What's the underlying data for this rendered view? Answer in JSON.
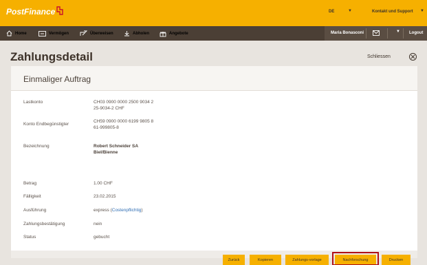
{
  "brand": {
    "logo_text": "PostFinance",
    "accent": "#f6b000",
    "nav_bg": "#4b3f35"
  },
  "header": {
    "language": "DE",
    "contact": "Kontakt und Support"
  },
  "nav": {
    "items": [
      {
        "label": "Home",
        "icon": "home-icon"
      },
      {
        "label": "Vermögen",
        "icon": "wallet-icon"
      },
      {
        "label": "Überweisen",
        "icon": "transfer-icon"
      },
      {
        "label": "Abholen",
        "icon": "download-icon"
      },
      {
        "label": "Angebote",
        "icon": "gift-icon"
      }
    ],
    "user": "Maria Bonasconi",
    "logout": "Logout"
  },
  "page": {
    "title": "Zahlungsdetail",
    "close_label": "Schliessen"
  },
  "card": {
    "title": "Einmaliger Auftrag",
    "fields": {
      "lastkonto_label": "Lastkonto",
      "lastkonto_line1": "CH03 0900 0000 2500 9034 2",
      "lastkonto_line2": "25-9034-2 CHF",
      "konto_label": "Konto Endbegünstigter",
      "konto_line1": "CH59 0900 0000 6199 9805 8",
      "konto_line2": "61-999805-8",
      "bezeichnung_label": "Bezeichnung",
      "bezeichnung_line1": "Robert Schneider SA",
      "bezeichnung_line2": "Biel/Bienne",
      "betrag_label": "Betrag",
      "betrag_value": "1.00 CHF",
      "faelligkeit_label": "Fälligkeit",
      "faelligkeit_value": "23.02.2015",
      "ausfuehrung_label": "Ausführung",
      "ausfuehrung_value": "express",
      "ausfuehrung_link": "Costenpflichtig",
      "zahlungsbest_label": "Zahlungsbestätigung",
      "zahlungsbest_value": "nein",
      "status_label": "Status",
      "status_value": "gebucht"
    }
  },
  "buttons": {
    "zurueck": "Zurück",
    "kopieren": "Kopieren",
    "zahlungsvorlage": "Zahlungs-vorlage",
    "nachforschung": "Nachforschung",
    "drucken": "Drucken"
  }
}
